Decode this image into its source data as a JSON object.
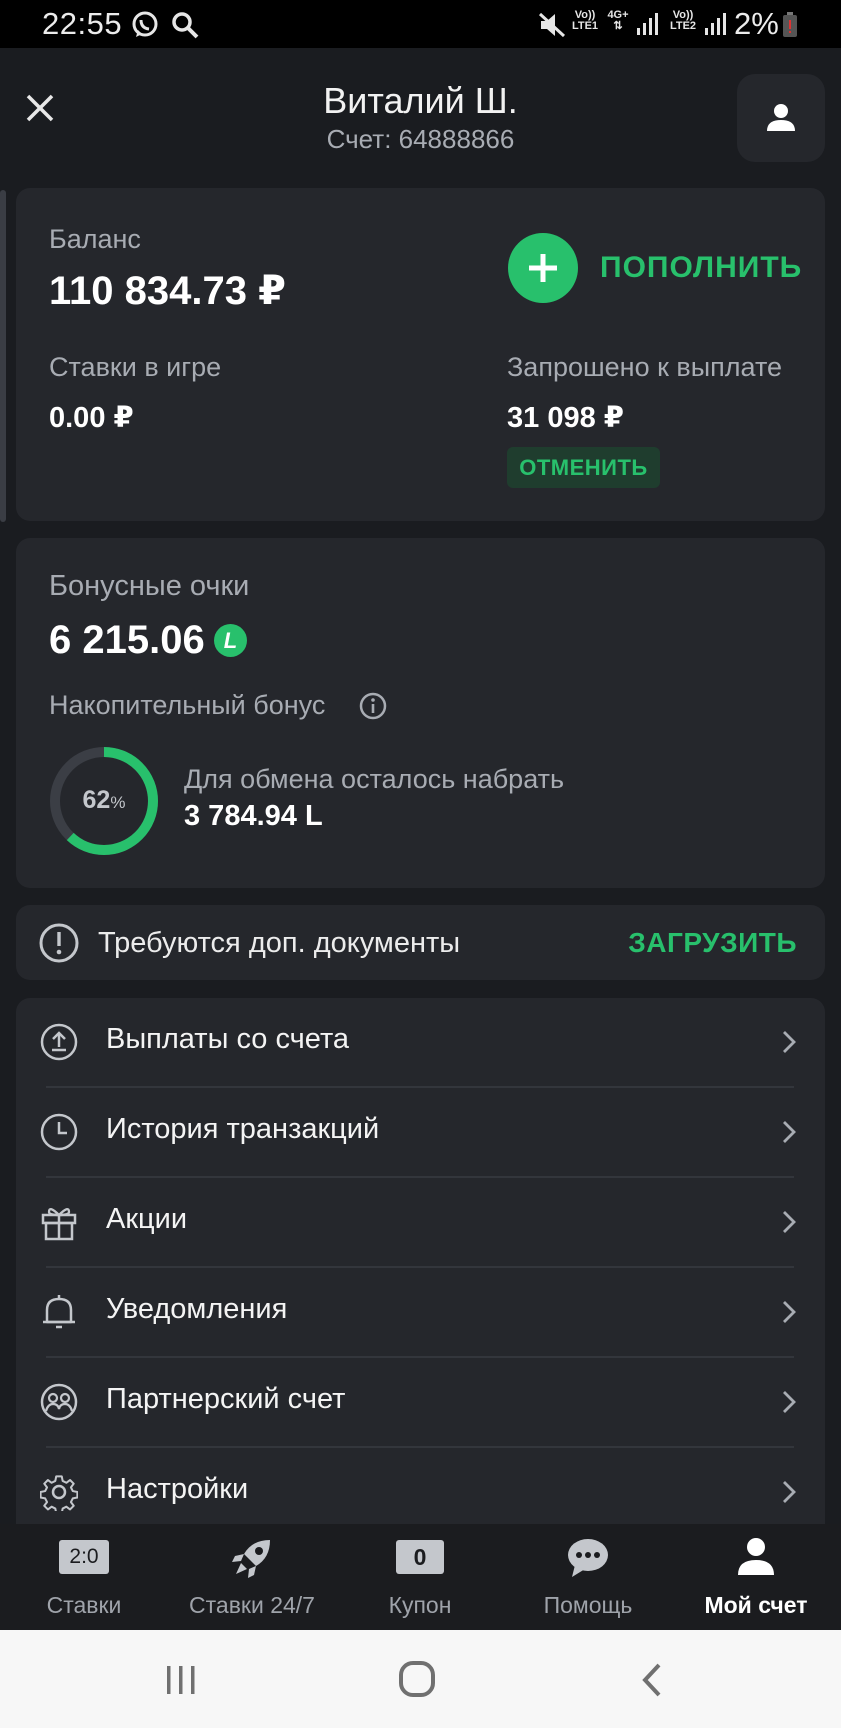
{
  "status_bar": {
    "time": "22:55",
    "battery_percent": "2%",
    "net1_top": "Vo))",
    "net1_bottom": "LTE1",
    "net_mid": "4G+",
    "net2_top": "Vo))",
    "net2_bottom": "LTE2"
  },
  "header": {
    "user_name": "Виталий Ш.",
    "account_label": "Счет: 64888866"
  },
  "balance_card": {
    "balance_label": "Баланс",
    "balance_value": "110 834.73 ₽",
    "deposit_label": "ПОПОЛНИТЬ",
    "bets_label": "Ставки в игре",
    "bets_value": "0.00 ₽",
    "withdraw_label": "Запрошено к выплате",
    "withdraw_value": "31 098 ₽",
    "cancel_label": "ОТМЕНИТЬ"
  },
  "bonus_card": {
    "title": "Бонусные очки",
    "points": "6 215.06",
    "points_badge": "L",
    "cumulative_label": "Накопительный бонус",
    "progress_number": "62",
    "progress_unit": "%",
    "progress_fraction": 0.62,
    "exchange_label": "Для обмена осталось набрать",
    "exchange_value": "3 784.94 L"
  },
  "documents_banner": {
    "text": "Требуются доп. документы",
    "action": "ЗАГРУЗИТЬ"
  },
  "menu": [
    {
      "label": "Выплаты со счета",
      "icon": "upload-icon"
    },
    {
      "label": "История транзакций",
      "icon": "clock-icon"
    },
    {
      "label": "Акции",
      "icon": "gift-icon"
    },
    {
      "label": "Уведомления",
      "icon": "bell-icon"
    },
    {
      "label": "Партнерский счет",
      "icon": "partners-icon"
    },
    {
      "label": "Настройки",
      "icon": "gear-icon"
    }
  ],
  "bottom_nav": [
    {
      "label": "Ставки",
      "icon": "score-icon",
      "badge": "2:0",
      "active": false
    },
    {
      "label": "Ставки 24/7",
      "icon": "rocket-icon",
      "active": false
    },
    {
      "label": "Купон",
      "icon": "coupon-icon",
      "badge": "0",
      "active": false
    },
    {
      "label": "Помощь",
      "icon": "chat-icon",
      "active": false
    },
    {
      "label": "Мой счет",
      "icon": "user-icon",
      "active": true
    }
  ],
  "colors": {
    "accent_green": "#28c06c",
    "background": "#1a1c20",
    "card": "#25272c"
  }
}
